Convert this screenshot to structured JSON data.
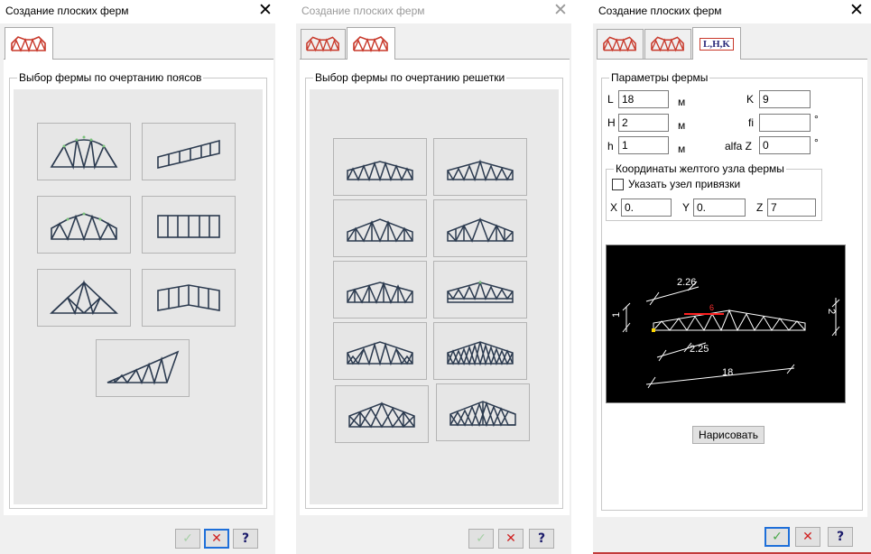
{
  "dialogs": [
    {
      "title": "Создание плоских ферм",
      "close": "✕",
      "group_label": "Выбор фермы по очертанию поясов"
    },
    {
      "title": "Создание плоских ферм",
      "close": "✕",
      "group_label": "Выбор фермы по очертанию решетки"
    },
    {
      "title": "Создание плоских ферм",
      "close": "✕"
    }
  ],
  "tab_lhk_label": "L,H,K",
  "params": {
    "group_label": "Параметры фермы",
    "L": {
      "label": "L",
      "value": "18",
      "unit": "м"
    },
    "H": {
      "label": "H",
      "value": "2",
      "unit": "м"
    },
    "h": {
      "label": "h",
      "value": "1",
      "unit": "м"
    },
    "K": {
      "label": "K",
      "value": "9"
    },
    "fi": {
      "label": "fi",
      "value": "",
      "unit": "°"
    },
    "alfaZ": {
      "label": "alfa Z",
      "value": "0",
      "unit": "°"
    }
  },
  "coords": {
    "group_label": "Координаты желтого узла фермы",
    "checkbox_label": "Указать узел привязки",
    "X": {
      "label": "X",
      "value": "0."
    },
    "Y": {
      "label": "Y",
      "value": "0."
    },
    "Z": {
      "label": "Z",
      "value": "7"
    }
  },
  "preview": {
    "d1": "2.26",
    "d2": "1",
    "d3": "2",
    "d4": "2.25",
    "d5": "18",
    "d6": "6"
  },
  "draw_button": "Нарисовать",
  "buttons": {
    "ok": "✓",
    "cancel": "✕",
    "help": "?"
  },
  "colors": {
    "ok": "#4aa84a",
    "ok_disabled": "#a6cfa6",
    "cancel": "#d02020",
    "help": "#1a1a6a",
    "truss": "#2b3a4f",
    "node": "#7cc37c"
  }
}
